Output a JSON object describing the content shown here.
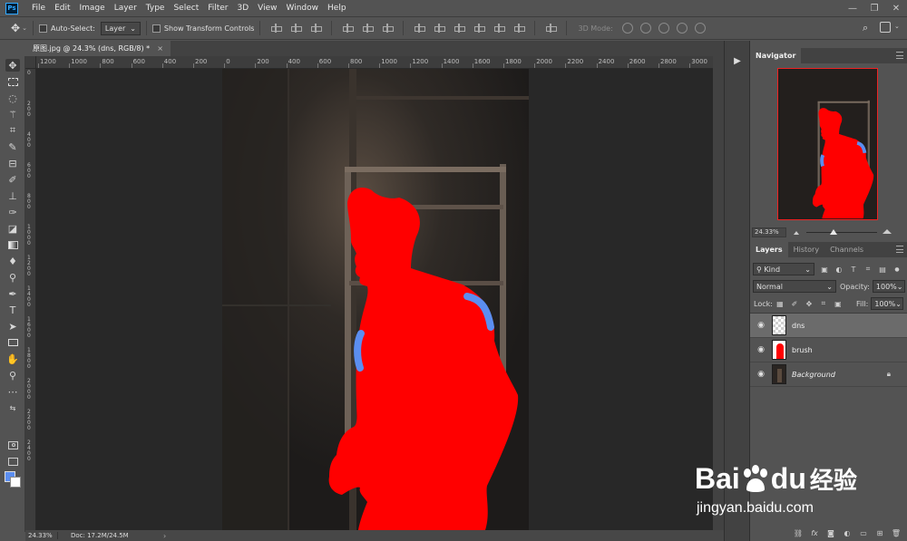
{
  "app": {
    "logo_text": "Ps"
  },
  "menu": [
    "File",
    "Edit",
    "Image",
    "Layer",
    "Type",
    "Select",
    "Filter",
    "3D",
    "View",
    "Window",
    "Help"
  ],
  "window_controls": {
    "minimize": "—",
    "restore": "❐",
    "close": "✕"
  },
  "options_bar": {
    "auto_select_label": "Auto-Select:",
    "auto_select_value": "Layer",
    "show_transform_label": "Show Transform Controls",
    "mode_3d_label": "3D Mode:"
  },
  "document_tab": {
    "title": "原图.jpg @ 24.3% (dns, RGB/8) *",
    "close": "×"
  },
  "ruler": {
    "top_labels": [
      "1200",
      "1000",
      "800",
      "600",
      "400",
      "200",
      "0",
      "200",
      "400",
      "600",
      "800",
      "1000",
      "1200",
      "1400",
      "1600",
      "1800",
      "2000",
      "2200",
      "2400",
      "2600",
      "2800",
      "3000"
    ],
    "left_labels": [
      "0",
      "2 0 0",
      "4 0 0",
      "6 0 0",
      "8 0 0",
      "1 0 0 0",
      "1 2 0 0",
      "1 4 0 0",
      "1 6 0 0",
      "1 8 0 0",
      "2 0 0 0",
      "2 2 0 0",
      "2 4 0 0"
    ]
  },
  "status_bar": {
    "zoom": "24.33%",
    "doc": "Doc: 17.2M/24.5M",
    "arrow": "›"
  },
  "navigator": {
    "tab_label": "Navigator",
    "zoom": "24.33%"
  },
  "layers_panel": {
    "tabs": [
      "Layers",
      "History",
      "Channels"
    ],
    "filter_label": "Kind",
    "blend_mode": "Normal",
    "opacity_label": "Opacity:",
    "opacity_value": "100%",
    "lock_label": "Lock:",
    "fill_label": "Fill:",
    "fill_value": "100%",
    "layers": [
      {
        "name": "dns",
        "selected": true,
        "italic": false,
        "locked": false
      },
      {
        "name": "brush",
        "selected": false,
        "italic": false,
        "locked": false
      },
      {
        "name": "Background",
        "selected": false,
        "italic": true,
        "locked": true
      }
    ],
    "footer_fx": "fx"
  },
  "watermark": {
    "brand_left": "Bai",
    "brand_right": "du",
    "brand_cn": "经验",
    "url": "jingyan.baidu.com"
  },
  "colors": {
    "mask_red": "#ff0000",
    "highlight_blue": "#5b8ef0",
    "foreground": "#5b8ef0",
    "background": "#ffffff"
  },
  "icons": [
    "move-icon",
    "marquee-icon",
    "lasso-icon",
    "magic-wand-icon",
    "crop-icon",
    "eyedropper-icon",
    "healing-icon",
    "brush-icon",
    "stamp-icon",
    "history-brush-icon",
    "eraser-icon",
    "gradient-icon",
    "blur-icon",
    "dodge-icon",
    "pen-icon",
    "type-icon",
    "path-select-icon",
    "rectangle-icon",
    "hand-icon",
    "zoom-icon",
    "more-tools-icon",
    "swap-colors-icon",
    "quick-mask-icon",
    "screen-mode-icon"
  ]
}
